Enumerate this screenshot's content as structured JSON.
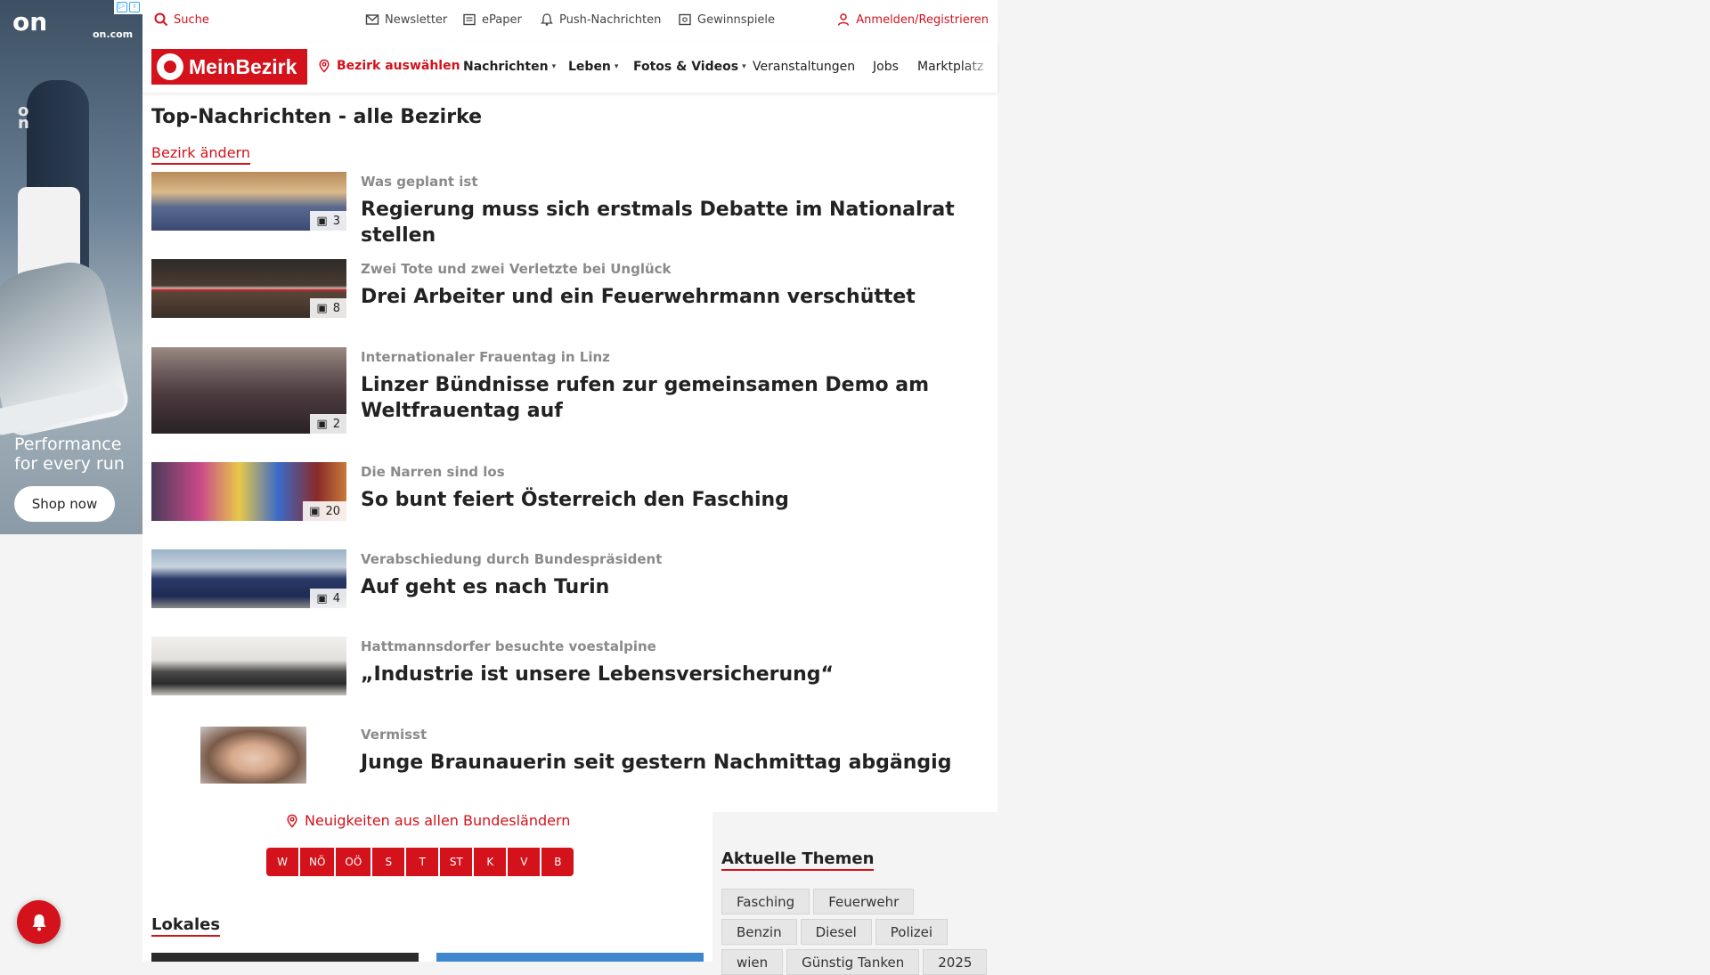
{
  "ad": {
    "logo": "on",
    "domain": "on.com",
    "tagline": "Performance for every run",
    "cta": "Shop now"
  },
  "utility": {
    "search": "Suche",
    "newsletter": "Newsletter",
    "epaper": "ePaper",
    "push": "Push-Nachrichten",
    "gewinnspiele": "Gewinnspiele",
    "login": "Anmelden/Registrieren"
  },
  "nav": {
    "brand": "MeinBezirk",
    "bezirk": "Bezirk auswählen",
    "items": [
      "Nachrichten",
      "Leben",
      "Fotos & Videos",
      "Veranstaltungen",
      "Jobs",
      "Marktplatz"
    ]
  },
  "page": {
    "title": "Top-Nachrichten - alle Bezirke",
    "change_link": "Bezirk ändern"
  },
  "articles": [
    {
      "kicker": "Was geplant ist",
      "headline": "Regierung muss sich erstmals Debatte im Nationalrat stellen",
      "count": "3"
    },
    {
      "kicker": "Zwei Tote und zwei Verletzte bei Unglück",
      "headline": "Drei Arbeiter und ein Feuerwehrmann verschüttet",
      "count": "8"
    },
    {
      "kicker": "Internationaler Frauentag in Linz",
      "headline": "Linzer Bündnisse rufen zur gemeinsamen Demo am Weltfrauentag auf",
      "count": "2"
    },
    {
      "kicker": "Die Narren sind los",
      "headline": "So bunt feiert Österreich den Fasching",
      "count": "20"
    },
    {
      "kicker": "Verabschiedung durch Bundespräsident",
      "headline": "Auf geht es nach Turin",
      "count": "4"
    },
    {
      "kicker": "Hattmannsdorfer besuchte voestalpine",
      "headline": "„Industrie ist unsere Lebensversicherung“",
      "count": ""
    },
    {
      "kicker": "Vermisst",
      "headline": "Junge Braunauerin seit gestern Nachmittag abgängig",
      "count": ""
    }
  ],
  "regions": {
    "title": "Neuigkeiten aus allen Bundesländern",
    "items": [
      "W",
      "NÖ",
      "OÖ",
      "S",
      "T",
      "ST",
      "K",
      "V",
      "B"
    ]
  },
  "lokales": {
    "title": "Lokales"
  },
  "topics": {
    "title": "Aktuelle Themen",
    "tags": [
      "Fasching",
      "Feuerwehr",
      "Benzin",
      "Diesel",
      "Polizei",
      "wien",
      "Günstig Tanken",
      "2025"
    ]
  }
}
